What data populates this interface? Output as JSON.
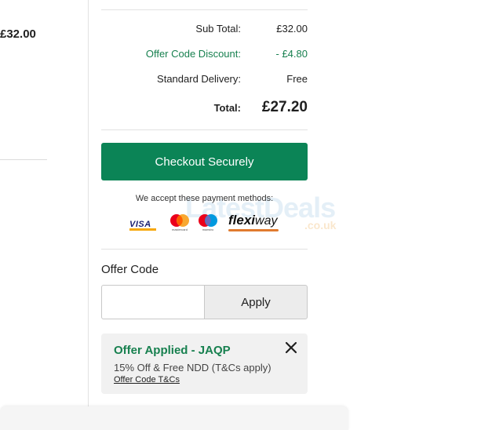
{
  "left_panel": {
    "item_price": "£32.00"
  },
  "summary": {
    "subtotal_label": "Sub Total:",
    "subtotal_value": "£32.00",
    "discount_label": "Offer Code Discount:",
    "discount_value": "- £4.80",
    "delivery_label": "Standard Delivery:",
    "delivery_value": "Free",
    "total_label": "Total:",
    "total_value": "£27.20"
  },
  "checkout": {
    "button_label": "Checkout Securely"
  },
  "payment": {
    "accept_text": "We accept these payment methods:",
    "methods": [
      {
        "name": "visa",
        "label": "VISA"
      },
      {
        "name": "mastercard",
        "label": "mastercard"
      },
      {
        "name": "maestro",
        "label": "maestro"
      },
      {
        "name": "flexiway",
        "label_part1": "flexi",
        "label_part2": "way"
      }
    ]
  },
  "watermark": {
    "text": "LatestDeals",
    "sub": ".co.uk"
  },
  "offer": {
    "title": "Offer Code",
    "input_value": "",
    "apply_label": "Apply",
    "applied_title": "Offer Applied - JAQP",
    "applied_desc": "15% Off & Free NDD (T&Cs apply)",
    "terms_link": "Offer Code T&Cs"
  },
  "colors": {
    "accent_green": "#0b8456",
    "discount_green": "#17804f",
    "text": "#1f1f1f"
  }
}
